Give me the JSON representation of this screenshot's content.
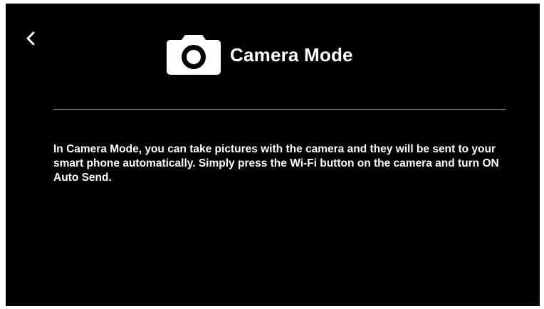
{
  "nav": {
    "back_icon": "chevron-left-icon"
  },
  "header": {
    "icon": "camera-icon",
    "title": "Camera Mode"
  },
  "content": {
    "description": "In Camera Mode, you can take pictures with the camera and they will be sent to your smart phone automatically. Simply press the Wi-Fi button on the camera and turn ON Auto Send."
  },
  "colors": {
    "background": "#000000",
    "text": "#ffffff",
    "divider": "#9a9a9a"
  }
}
